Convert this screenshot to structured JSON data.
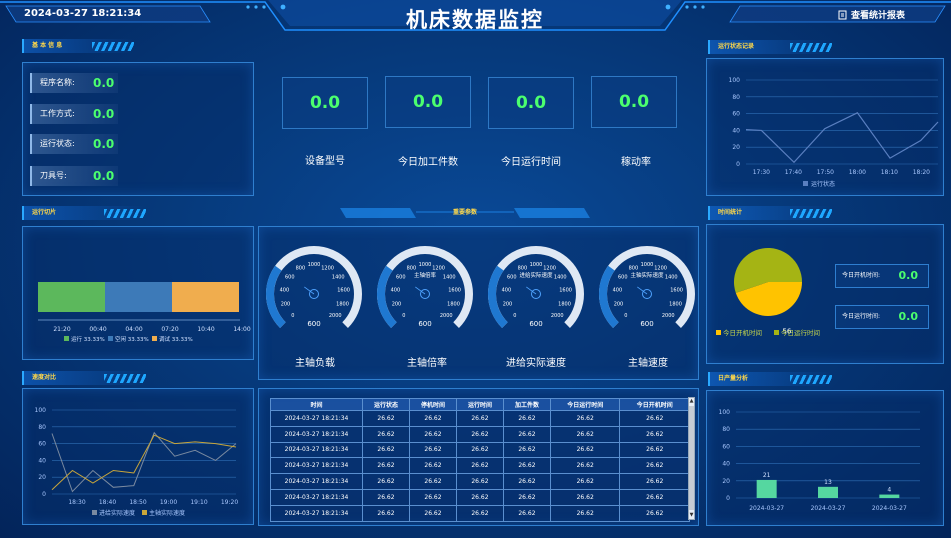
{
  "header": {
    "title": "机床数据监控",
    "datetime": "2024-03-27 18:21:34",
    "report_button": "查看统计报表"
  },
  "sections": {
    "basic": "基 本 信 息",
    "run_log": "运行状态记录",
    "run_slice": "运行切片",
    "main_params": "重要参数",
    "time_stats": "时间统计",
    "speed_compare": "速度对比",
    "daily_output": "日产量分析"
  },
  "basic_info": [
    {
      "label": "程序名称:",
      "value": "0.0"
    },
    {
      "label": "工作方式:",
      "value": "0.0"
    },
    {
      "label": "运行状态:",
      "value": "0.0"
    },
    {
      "label": "刀具号:",
      "value": "0.0"
    }
  ],
  "kpis": [
    {
      "label": "设备型号",
      "value": "0.0"
    },
    {
      "label": "今日加工件数",
      "value": "0.0"
    },
    {
      "label": "今日运行时间",
      "value": "0.0"
    },
    {
      "label": "稼动率",
      "value": "0.0"
    }
  ],
  "gauges": [
    {
      "label": "主轴负载",
      "value": 600,
      "title": ""
    },
    {
      "label": "主轴倍率",
      "value": 600,
      "title": "主轴倍率"
    },
    {
      "label": "进给实际速度",
      "value": 600,
      "title": "进给实际速度"
    },
    {
      "label": "主轴速度",
      "value": 600,
      "title": "主轴实际速度"
    }
  ],
  "gauge_ticks": [
    "0",
    "200",
    "400",
    "600",
    "800",
    "1000",
    "1200",
    "1400",
    "1600",
    "1800",
    "2000"
  ],
  "time_stats": {
    "legend": [
      "今日开机时间",
      "今日运行时间"
    ],
    "slices": [
      {
        "name": "今日开机时间",
        "value": 56,
        "color": "#ffc300"
      },
      {
        "name": "今日运行时间",
        "value": 69,
        "color": "#a5b414"
      }
    ],
    "boot_label": "今日开机时间:",
    "boot_value": "0.0",
    "run_label": "今日运行时间:",
    "run_value": "0.0"
  },
  "table": {
    "headers": [
      "时间",
      "运行状态",
      "停机时间",
      "运行时间",
      "加工件数",
      "今日运行时间",
      "今日开机时间"
    ],
    "rows": [
      [
        "2024-03-27 18:21:34",
        "26.62",
        "26.62",
        "26.62",
        "26.62",
        "26.62",
        "26.62"
      ],
      [
        "2024-03-27 18:21:34",
        "26.62",
        "26.62",
        "26.62",
        "26.62",
        "26.62",
        "26.62"
      ],
      [
        "2024-03-27 18:21:34",
        "26.62",
        "26.62",
        "26.62",
        "26.62",
        "26.62",
        "26.62"
      ],
      [
        "2024-03-27 18:21:34",
        "26.62",
        "26.62",
        "26.62",
        "26.62",
        "26.62",
        "26.62"
      ],
      [
        "2024-03-27 18:21:34",
        "26.62",
        "26.62",
        "26.62",
        "26.62",
        "26.62",
        "26.62"
      ],
      [
        "2024-03-27 18:21:34",
        "26.62",
        "26.62",
        "26.62",
        "26.62",
        "26.62",
        "26.62"
      ],
      [
        "2024-03-27 18:21:34",
        "26.62",
        "26.62",
        "26.62",
        "26.62",
        "26.62",
        "26.62"
      ]
    ]
  },
  "colors": {
    "green": "#4bff6e",
    "yellow": "#ffd84a",
    "line_blue": "#5a7fc0"
  },
  "chart_data": [
    {
      "type": "line",
      "id": "run_log",
      "x": [
        "17:30",
        "17:40",
        "17:50",
        "18:00",
        "18:10",
        "18:20"
      ],
      "x_values": [
        17.42,
        17.5,
        17.67,
        17.83,
        18.0,
        18.17,
        18.33,
        18.42
      ],
      "series": [
        {
          "name": "运行状态",
          "values": [
            41,
            40,
            2,
            42,
            61,
            7,
            28,
            50
          ]
        }
      ],
      "ylim": [
        0,
        100
      ],
      "yticks": [
        "0",
        "20",
        "40",
        "60",
        "80",
        "100"
      ]
    },
    {
      "type": "bar",
      "id": "run_slice",
      "stacked": true,
      "categories": [
        "运行",
        "空闲",
        "调试"
      ],
      "values": [
        33.33,
        33.33,
        33.33
      ],
      "colors": [
        "#5cb85c",
        "#3d7ab8",
        "#f0ad4e"
      ],
      "legend": [
        "运行 33.33%",
        "空闲 33.33%",
        "调试 33.33%"
      ],
      "xticks": [
        "21:20",
        "00:40",
        "04:00",
        "07:20",
        "10:40",
        "14:00",
        "17:20"
      ]
    },
    {
      "type": "line",
      "id": "speed_compare",
      "x": [
        "18:30",
        "18:40",
        "18:50",
        "19:00",
        "19:10",
        "19:20"
      ],
      "series": [
        {
          "name": "进给实际速度",
          "color": "#7a8aa0",
          "values": [
            72,
            3,
            28,
            8,
            10,
            73,
            45,
            52,
            40,
            60
          ]
        },
        {
          "name": "主轴实际速度",
          "color": "#c9a63a",
          "values": [
            5,
            28,
            13,
            28,
            25,
            70,
            60,
            62,
            60,
            56
          ]
        }
      ],
      "ylim": [
        0,
        100
      ],
      "yticks": [
        "0",
        "20",
        "40",
        "60",
        "80",
        "100"
      ]
    },
    {
      "type": "bar",
      "id": "daily_output",
      "categories": [
        "2024-03-27",
        "2024-03-27",
        "2024-03-27"
      ],
      "values": [
        21,
        13,
        4
      ],
      "ylim": [
        0,
        100
      ],
      "yticks": [
        "0",
        "20",
        "40",
        "60",
        "80",
        "100"
      ]
    }
  ]
}
